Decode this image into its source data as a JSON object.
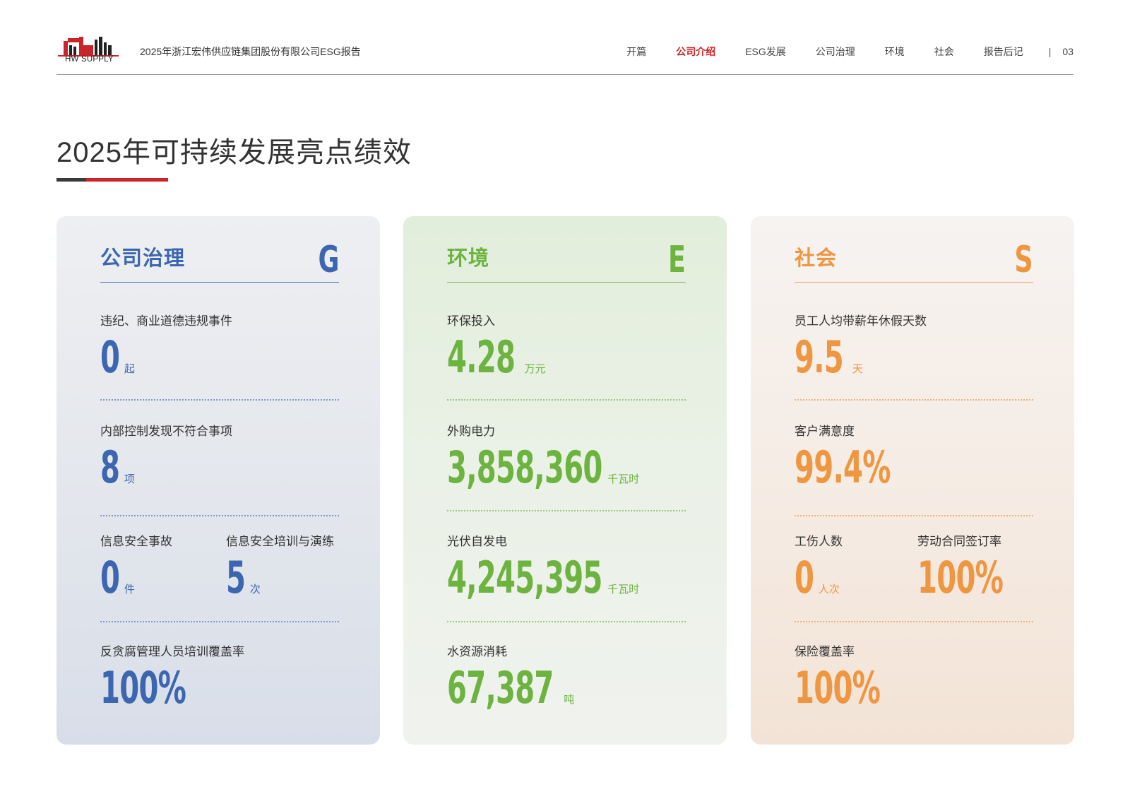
{
  "header": {
    "logo_text": "HW SUPPLY",
    "report_title": "2025年浙江宏伟供应链集团股份有限公司ESG报告",
    "nav": [
      "开篇",
      "公司介绍",
      "ESG发展",
      "公司治理",
      "环境",
      "社会",
      "报告后记"
    ],
    "active_nav": "公司介绍",
    "separator": "|",
    "page_number": "03"
  },
  "page_title": "2025年可持续发展亮点绩效",
  "colors": {
    "governance": "#3d66b0",
    "environment": "#6db33f",
    "social": "#ee9640",
    "brand_red": "#cc2229"
  },
  "cards": {
    "governance": {
      "title": "公司治理",
      "letter": "G",
      "metrics": [
        {
          "label": "违纪、商业道德违规事件",
          "value": "0",
          "unit": "起"
        },
        {
          "label": "内部控制发现不符合事项",
          "value": "8",
          "unit": "项"
        },
        {
          "label": "信息安全事故",
          "value": "0",
          "unit": "件"
        },
        {
          "label": "信息安全培训与演练",
          "value": "5",
          "unit": "次"
        },
        {
          "label": "反贪腐管理人员培训覆盖率",
          "value": "100%",
          "unit": ""
        }
      ]
    },
    "environment": {
      "title": "环境",
      "letter": "E",
      "metrics": [
        {
          "label": "环保投入",
          "value": "4.28",
          "unit": "万元"
        },
        {
          "label": "外购电力",
          "value": "3,858,360",
          "unit": "千瓦时"
        },
        {
          "label": "光伏自发电",
          "value": "4,245,395",
          "unit": "千瓦时"
        },
        {
          "label": "水资源消耗",
          "value": "67,387",
          "unit": "吨"
        }
      ]
    },
    "social": {
      "title": "社会",
      "letter": "S",
      "metrics": [
        {
          "label": "员工人均带薪年休假天数",
          "value": "9.5",
          "unit": "天"
        },
        {
          "label": "客户满意度",
          "value": "99.4%",
          "unit": ""
        },
        {
          "label": "工伤人数",
          "value": "0",
          "unit": "人次"
        },
        {
          "label": "劳动合同签订率",
          "value": "100%",
          "unit": ""
        },
        {
          "label": "保险覆盖率",
          "value": "100%",
          "unit": ""
        }
      ]
    }
  }
}
